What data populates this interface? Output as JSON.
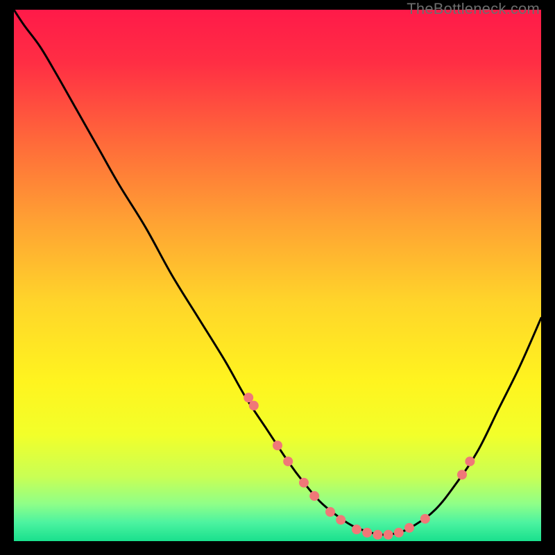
{
  "watermark": "TheBottleneck.com",
  "chart_data": {
    "type": "line",
    "title": "",
    "xlabel": "",
    "ylabel": "",
    "xlim": [
      0,
      100
    ],
    "ylim": [
      0,
      100
    ],
    "background_gradient": {
      "stops": [
        {
          "offset": 0.0,
          "color": "#ff1a49"
        },
        {
          "offset": 0.1,
          "color": "#ff2e44"
        },
        {
          "offset": 0.25,
          "color": "#ff6a3a"
        },
        {
          "offset": 0.4,
          "color": "#ffa233"
        },
        {
          "offset": 0.55,
          "color": "#ffd52a"
        },
        {
          "offset": 0.7,
          "color": "#fff41f"
        },
        {
          "offset": 0.8,
          "color": "#f2ff2a"
        },
        {
          "offset": 0.88,
          "color": "#c8ff55"
        },
        {
          "offset": 0.93,
          "color": "#8fff88"
        },
        {
          "offset": 0.965,
          "color": "#4cf3a0"
        },
        {
          "offset": 1.0,
          "color": "#19e08d"
        }
      ]
    },
    "series": [
      {
        "name": "bottleneck-curve",
        "x": [
          0,
          2,
          5,
          8,
          12,
          16,
          20,
          25,
          30,
          35,
          40,
          44,
          48,
          52,
          55,
          58,
          61,
          64,
          67,
          70,
          73,
          76,
          80,
          84,
          88,
          92,
          96,
          100
        ],
        "y": [
          100,
          97,
          93,
          88,
          81,
          74,
          67,
          59,
          50,
          42,
          34,
          27,
          21,
          15,
          11,
          7.5,
          5,
          3,
          1.8,
          1.2,
          1.6,
          3,
          6,
          11,
          17,
          25,
          33,
          42
        ]
      }
    ],
    "markers": {
      "name": "highlight-points",
      "x": [
        44.5,
        45.5,
        50,
        52,
        55,
        57,
        60,
        62,
        65,
        67,
        69,
        71,
        73,
        75,
        78,
        85,
        86.5
      ],
      "y": [
        27,
        25.5,
        18,
        15,
        11,
        8.5,
        5.5,
        4,
        2.2,
        1.6,
        1.2,
        1.2,
        1.6,
        2.5,
        4.2,
        12.5,
        15
      ],
      "color": "#f07878",
      "radius": 7
    }
  }
}
